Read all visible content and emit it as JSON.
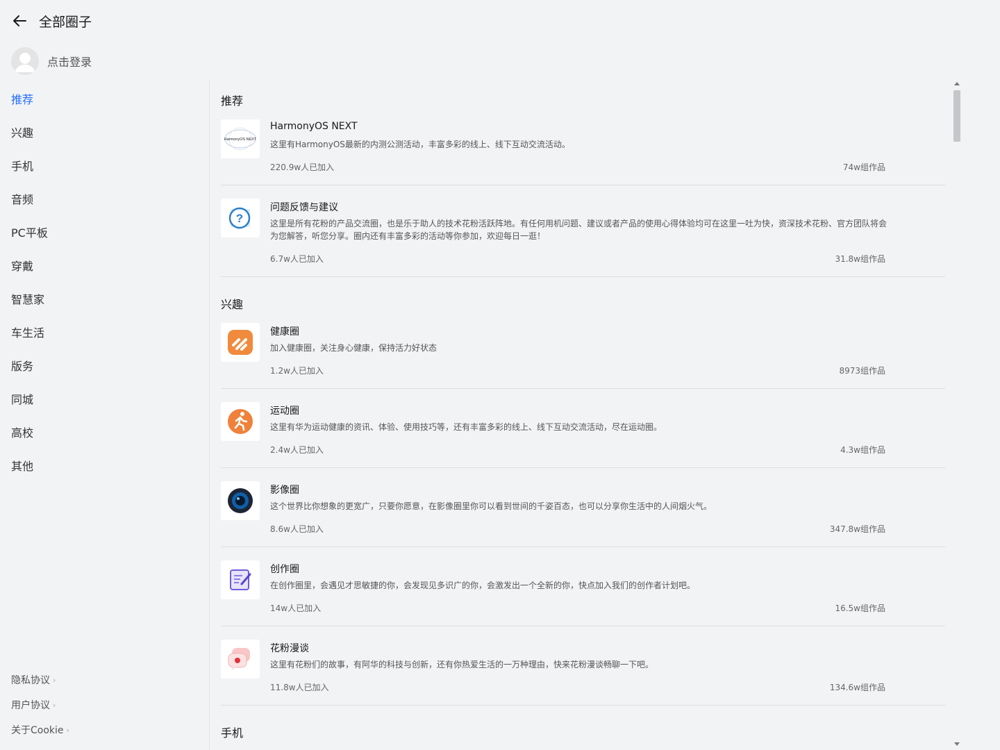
{
  "header": {
    "title": "全部圈子",
    "back_icon": "arrow-left-icon"
  },
  "user": {
    "login_label": "点击登录",
    "avatar_icon": "avatar-placeholder-icon"
  },
  "sidebar": {
    "accent_color": "#256fff",
    "items": [
      {
        "label": "推荐",
        "active": true
      },
      {
        "label": "兴趣"
      },
      {
        "label": "手机"
      },
      {
        "label": "音频"
      },
      {
        "label": "PC平板"
      },
      {
        "label": "穿戴"
      },
      {
        "label": "智慧家"
      },
      {
        "label": "车生活"
      },
      {
        "label": "版务"
      },
      {
        "label": "同城"
      },
      {
        "label": "高校"
      },
      {
        "label": "其他"
      }
    ],
    "footer": [
      {
        "label": "隐私协议"
      },
      {
        "label": "用户协议"
      },
      {
        "label": "关于Cookie"
      }
    ]
  },
  "sections": [
    {
      "title": "推荐",
      "cards": [
        {
          "icon": "harmonyos-next-icon",
          "icon_text": "HarmonyOS NEXT",
          "name": "HarmonyOS NEXT",
          "desc": "这里有HarmonyOS最新的内测公测活动，丰富多彩的线上、线下互动交流活动。",
          "members": "220.9w人已加入",
          "works": "74w组作品"
        },
        {
          "icon": "question-feedback-icon",
          "name": "问题反馈与建议",
          "desc": "这里是所有花粉的产品交流圈，也是乐于助人的技术花粉活跃阵地。有任何用机问题、建议或者产品的使用心得体验均可在这里一吐为快，资深技术花粉、官方团队将会为您解答，听您分享。圈内还有丰富多彩的活动等你参加，欢迎每日一逛！",
          "members": "6.7w人已加入",
          "works": "31.8w组作品"
        }
      ]
    },
    {
      "title": "兴趣",
      "cards": [
        {
          "icon": "health-heart-icon",
          "name": "健康圈",
          "desc": "加入健康圈，关注身心健康，保持活力好状态",
          "members": "1.2w人已加入",
          "works": "8973组作品"
        },
        {
          "icon": "running-person-icon",
          "name": "运动圈",
          "desc": "这里有华为运动健康的资讯、体验、使用技巧等，还有丰富多彩的线上、线下互动交流活动，尽在运动圈。",
          "members": "2.4w人已加入",
          "works": "4.3w组作品"
        },
        {
          "icon": "camera-lens-icon",
          "name": "影像圈",
          "desc": "这个世界比你想象的更宽广，只要你愿意，在影像圈里你可以看到世间的千姿百态，也可以分享你生活中的人间烟火气。",
          "members": "8.6w人已加入",
          "works": "347.8w组作品"
        },
        {
          "icon": "edit-note-icon",
          "name": "创作圈",
          "desc": "在创作圈里，会遇见才思敏捷的你，会发现见多识广的你，会激发出一个全新的你，快点加入我们的创作者计划吧。",
          "members": "14w人已加入",
          "works": "16.5w组作品"
        },
        {
          "icon": "chat-bubbles-icon",
          "name": "花粉漫谈",
          "desc": "这里有花粉们的故事，有阿华的科技与创新，还有你热爱生活的一万种理由，快来花粉漫谈畅聊一下吧。",
          "members": "11.8w人已加入",
          "works": "134.6w组作品"
        }
      ]
    },
    {
      "title": "手机",
      "cards": []
    }
  ]
}
